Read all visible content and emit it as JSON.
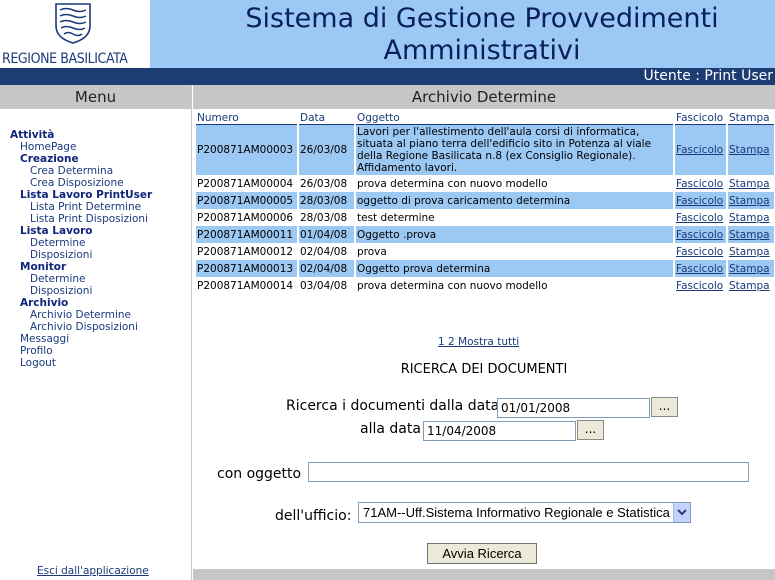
{
  "header": {
    "region_name": "REGIONE BASILICATA",
    "title_line1": "Sistema di Gestione Provvedimenti",
    "title_line2": "Amministrativi",
    "user_label": "Utente : Print User"
  },
  "menu": {
    "title": "Menu",
    "attivita": "Attività",
    "homepage": "HomePage",
    "creazione": "Creazione",
    "crea_determina": "Crea Determina",
    "crea_disposizione": "Crea Disposizione",
    "lista_printuser": "Lista Lavoro PrintUser",
    "lista_print_determine": "Lista Print Determine",
    "lista_print_disposizioni": "Lista Print Disposizioni",
    "lista_lavoro": "Lista Lavoro",
    "ll_determine": "Determine",
    "ll_disposizioni": "Disposizioni",
    "monitor": "Monitor",
    "mon_determine": "Determine",
    "mon_disposizioni": "Disposizioni",
    "archivio": "Archivio",
    "archivio_determine": "Archivio Determine",
    "archivio_disposizioni": "Archivio Disposizioni",
    "messaggi": "Messaggi",
    "profilo": "Profilo",
    "logout": "Logout",
    "exit": "Esci dall'applicazione"
  },
  "main": {
    "title": "Archivio Determine",
    "columns": {
      "numero": "Numero",
      "data": "Data",
      "oggetto": "Oggetto",
      "fascicolo": "Fascicolo",
      "stampa": "Stampa"
    },
    "rows": [
      {
        "numero": "P200871AM00003",
        "data": "26/03/08",
        "oggetto": "Lavori per l'allestimento dell'aula corsi di informatica, situata al piano terra dell'edificio sito in Potenza al viale della Regione Basilicata n.8 (ex Consiglio Regionale). Affidamento lavori.",
        "fascicolo": "Fascicolo",
        "stampa": "Stampa"
      },
      {
        "numero": "P200871AM00004",
        "data": "26/03/08",
        "oggetto": "prova determina con nuovo modello",
        "fascicolo": "Fascicolo",
        "stampa": "Stampa"
      },
      {
        "numero": "P200871AM00005",
        "data": "28/03/08",
        "oggetto": "oggetto di prova caricamento determina",
        "fascicolo": "Fascicolo",
        "stampa": "Stampa"
      },
      {
        "numero": "P200871AM00006",
        "data": "28/03/08",
        "oggetto": "test determine",
        "fascicolo": "Fascicolo",
        "stampa": "Stampa"
      },
      {
        "numero": "P200871AM00011",
        "data": "01/04/08",
        "oggetto": "Oggetto .prova",
        "fascicolo": "Fascicolo",
        "stampa": "Stampa"
      },
      {
        "numero": "P200871AM00012",
        "data": "02/04/08",
        "oggetto": "prova",
        "fascicolo": "Fascicolo",
        "stampa": "Stampa"
      },
      {
        "numero": "P200871AM00013",
        "data": "02/04/08",
        "oggetto": "Oggetto  prova determina",
        "fascicolo": "Fascicolo",
        "stampa": "Stampa"
      },
      {
        "numero": "P200871AM00014",
        "data": "03/04/08",
        "oggetto": "prova determina con nuovo modello",
        "fascicolo": "Fascicolo",
        "stampa": "Stampa"
      }
    ],
    "pager": "1 2  Mostra tutti"
  },
  "search": {
    "title": "RICERCA DEI DOCUMENTI",
    "from_label": "Ricerca i documenti dalla data",
    "from_value": "01/01/2008",
    "to_label": "alla data",
    "to_value": "11/04/2008",
    "picker_label": "...",
    "subject_label": "con oggetto",
    "subject_value": "",
    "office_label": "dell'ufficio:",
    "office_value": "71AM--Uff.Sistema Informativo Regionale e Statistica",
    "button_label": "Avvia Ricerca"
  },
  "colors": {
    "header_bg": "#9cc8f4",
    "userbar_bg": "#1d3c72",
    "panel_head_bg": "#c6c6c6",
    "row_highlight": "#9cc8f4",
    "link": "#1a3a7a"
  }
}
